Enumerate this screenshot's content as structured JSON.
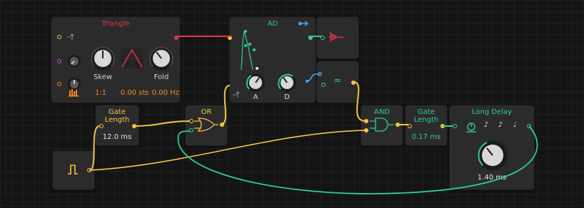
{
  "colors": {
    "red": "#e8334a",
    "green": "#2fcf8f",
    "yellow": "#f5c542",
    "orange": "#f08a24",
    "purple": "#c05ad8",
    "blue": "#3fa9f5",
    "panel": "#2b2b2b"
  },
  "triangle": {
    "title": "Triangle",
    "skew_label": "Skew",
    "fold_label": "Fold",
    "ratio": "1:1",
    "semitones": "0.00 st",
    "fine": "± 0.00 Hz"
  },
  "ad": {
    "title": "AD",
    "attack_label": "A",
    "decay_label": "D"
  },
  "gate_length_1": {
    "title": "Gate Length",
    "value": "12.0 ms"
  },
  "or_gate": {
    "title": "OR"
  },
  "and_gate": {
    "title": "AND"
  },
  "gate_length_2": {
    "title": "Gate Length",
    "value": "0.17 ms"
  },
  "long_delay": {
    "title": "Long Delay",
    "value": "1.40 ms",
    "note_icons": [
      "♪",
      "♪",
      "♩"
    ]
  },
  "filter_glyph": "≈"
}
